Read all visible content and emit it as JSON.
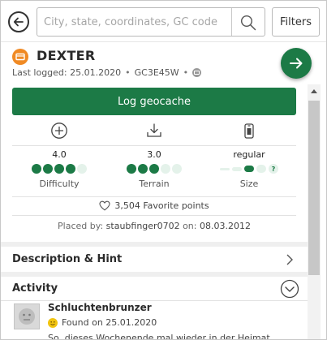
{
  "search": {
    "placeholder": "City, state, coordinates, GC code",
    "filters_label": "Filters"
  },
  "cache": {
    "name": "DEXTER",
    "last_logged": "Last logged: 25.01.2020",
    "separator": "•",
    "code": "GC3E45W",
    "type_icon": "traditional-cache-icon",
    "accent_color": "#1c7a46",
    "type_color": "#f08a24"
  },
  "actions": {
    "log_label": "Log geocache",
    "icons": [
      "add-icon",
      "download-icon",
      "phone-icon"
    ]
  },
  "ratings": {
    "difficulty": {
      "value": "4.0",
      "label": "Difficulty",
      "level": 4,
      "max": 5
    },
    "terrain": {
      "value": "3.0",
      "label": "Terrain",
      "level": 3,
      "max": 5
    },
    "size": {
      "value": "regular",
      "label": "Size",
      "level": 3,
      "max": 5
    }
  },
  "favorites": {
    "text": "3,504 Favorite points"
  },
  "placed": {
    "prefix": "Placed by:",
    "owner": "staubfinger0702",
    "mid": "on:",
    "date": "08.03.2012"
  },
  "sections": {
    "description": "Description & Hint",
    "activity": "Activity"
  },
  "log_entry": {
    "user": "Schluchtenbrunzer",
    "status": "Found on 25.01.2020",
    "text": "So, dieses Wochenende mal wieder in der Heimat"
  }
}
